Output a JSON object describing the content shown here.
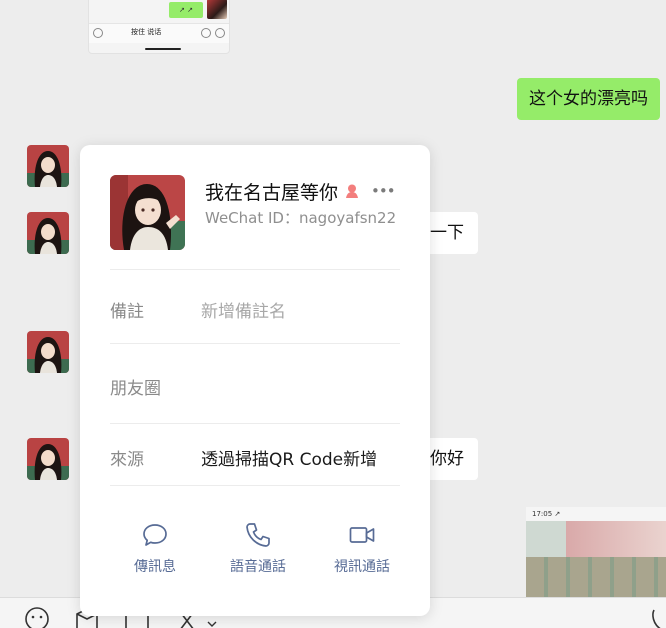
{
  "chat": {
    "top_screenshot": {
      "bubble_text": "↗ ↗",
      "hold_to_talk": "按住 说话"
    },
    "messages": {
      "right_1": "这个女的漂亮吗",
      "left_1_visible_text": "一下",
      "left_2_visible_text": "你好"
    },
    "bottom_screenshot": {
      "status_time": "17:05 ↗"
    }
  },
  "profile_card": {
    "nickname": "我在名古屋等你",
    "wechat_id": "WeChat ID：nagoyafsn22",
    "gender_icon": "female-icon",
    "more_icon": "•••",
    "fields": {
      "remark_label": "備註",
      "remark_placeholder": "新增備註名",
      "moments_label": "朋友圈",
      "source_label": "來源",
      "source_value": "透過掃描QR Code新增"
    },
    "actions": {
      "message": "傳訊息",
      "voice_call": "語音通話",
      "video_call": "視訊通話"
    }
  },
  "colors": {
    "accent_link": "#576b95",
    "bubble_green": "#95ec69",
    "gender_female": "#f37e7d"
  },
  "toolbar": {
    "icons": [
      "emoji-icon",
      "favorites-icon",
      "folder-icon",
      "scissors-icon",
      "chevron-down-icon"
    ]
  }
}
